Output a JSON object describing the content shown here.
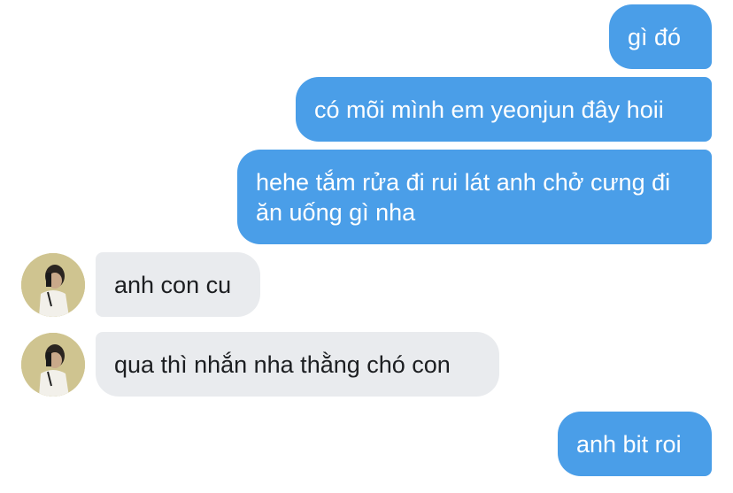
{
  "messages": [
    {
      "side": "sent",
      "text": "gì đó"
    },
    {
      "side": "sent",
      "text": "có mõi mình em yeonjun đây hoii"
    },
    {
      "side": "sent",
      "text": "hehe tắm rửa đi rui lát anh chở cưng đi ăn uống gì nha"
    },
    {
      "side": "received",
      "text": "anh con cu"
    },
    {
      "side": "received",
      "text": "qua thì nhắn nha thằng chó con"
    },
    {
      "side": "sent",
      "text": "anh bit roi"
    }
  ],
  "colors": {
    "sent_bubble": "#4a9ee8",
    "received_bubble": "#e9ebee",
    "sent_text": "#ffffff",
    "received_text": "#1c1e21"
  },
  "icons": {
    "contact_avatar": "contact-avatar-photo"
  }
}
